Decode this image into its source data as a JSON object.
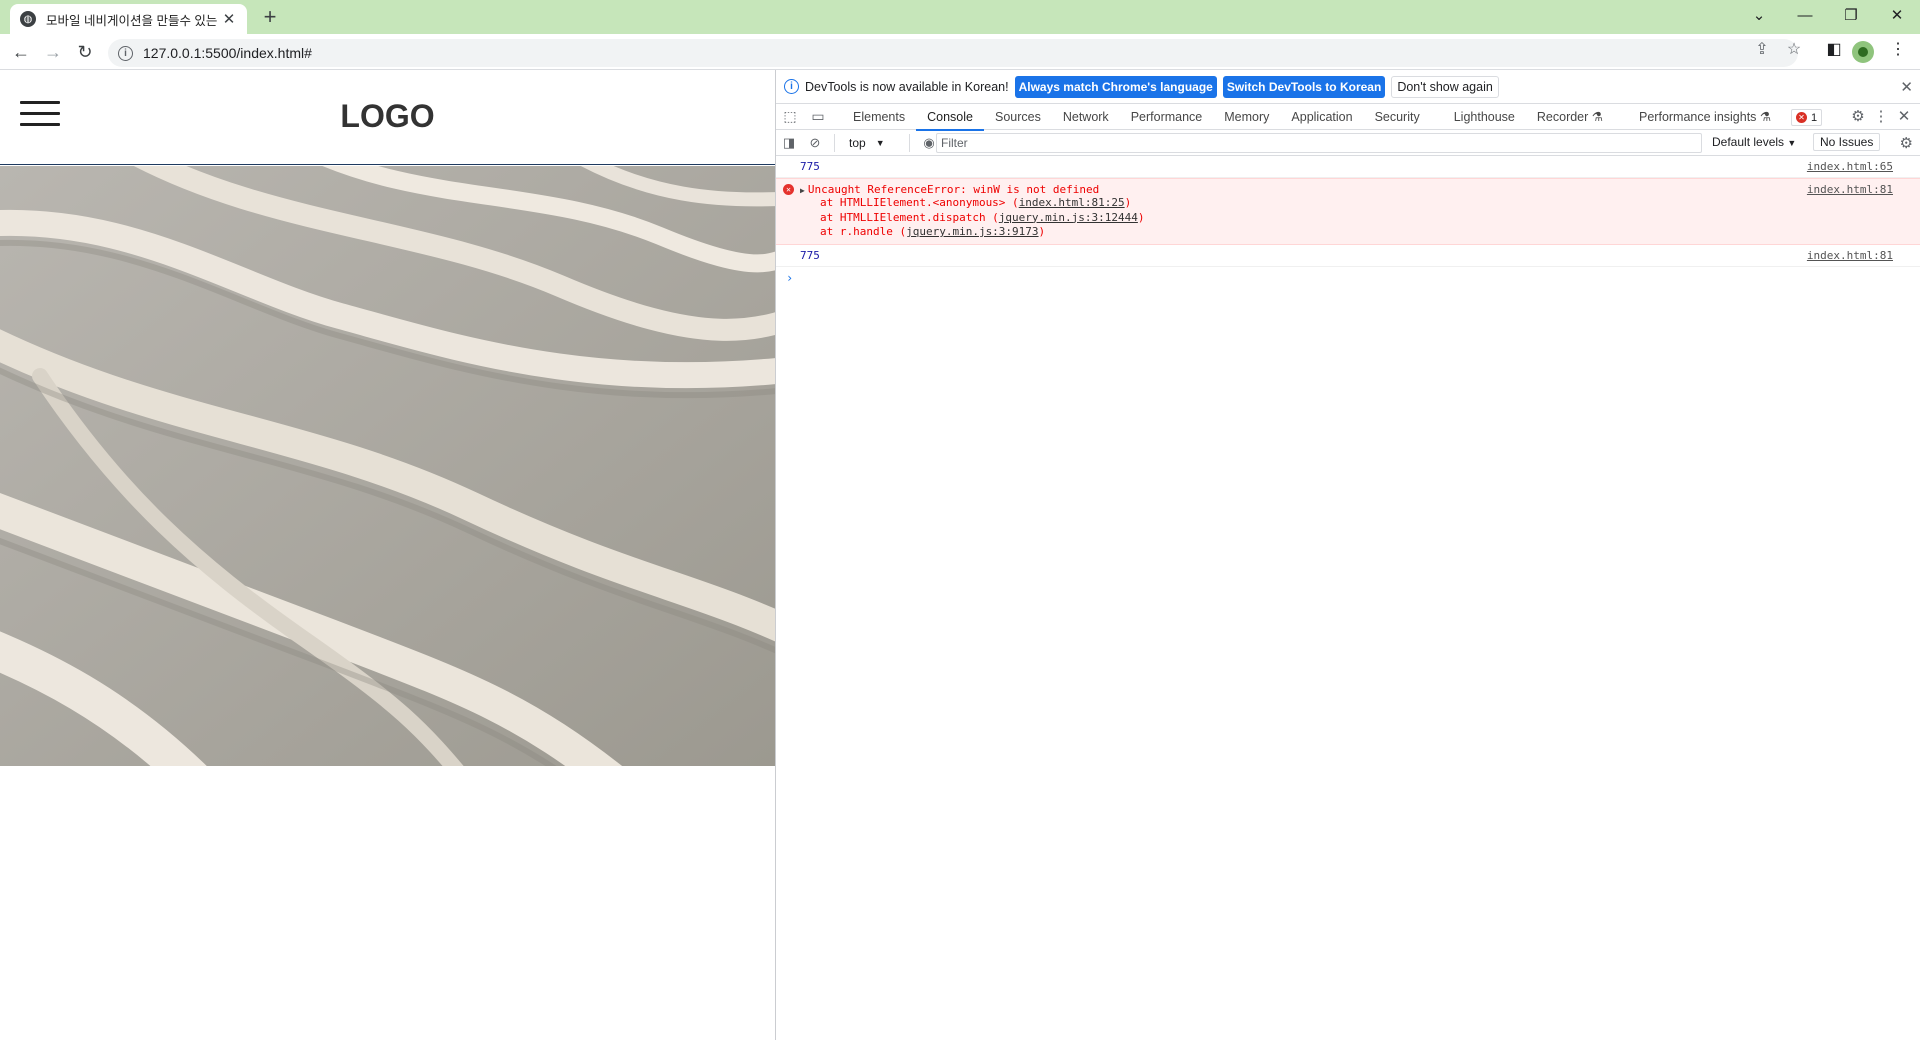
{
  "browser": {
    "tab_title": "모바일 네비게이션을 만들수 있는",
    "url": "127.0.0.1:5500/index.html#"
  },
  "page": {
    "logo": "LOGO"
  },
  "devtools": {
    "info_message": "DevTools is now available in Korean!",
    "btn_match": "Always match Chrome's language",
    "btn_switch": "Switch DevTools to Korean",
    "btn_dont_show": "Don't show again",
    "tabs": [
      "Elements",
      "Console",
      "Sources",
      "Network",
      "Performance",
      "Memory",
      "Application",
      "Security",
      "Lighthouse",
      "Recorder",
      "Performance insights"
    ],
    "error_count": "1",
    "context": "top",
    "filter_placeholder": "Filter",
    "levels": "Default levels",
    "issues": "No Issues",
    "console": {
      "row1_value": "775",
      "row1_source": "index.html:65",
      "error_message": "Uncaught ReferenceError: winW is not defined",
      "error_source": "index.html:81",
      "stack1_pre": "at HTMLLIElement.<anonymous> (",
      "stack1_link": "index.html:81:25",
      "stack2_pre": "at HTMLLIElement.dispatch (",
      "stack2_link": "jquery.min.js:3:12444",
      "stack3_pre": "at r.handle (",
      "stack3_link": "jquery.min.js:3:9173",
      "row3_value": "775",
      "row3_source": "index.html:81"
    }
  }
}
